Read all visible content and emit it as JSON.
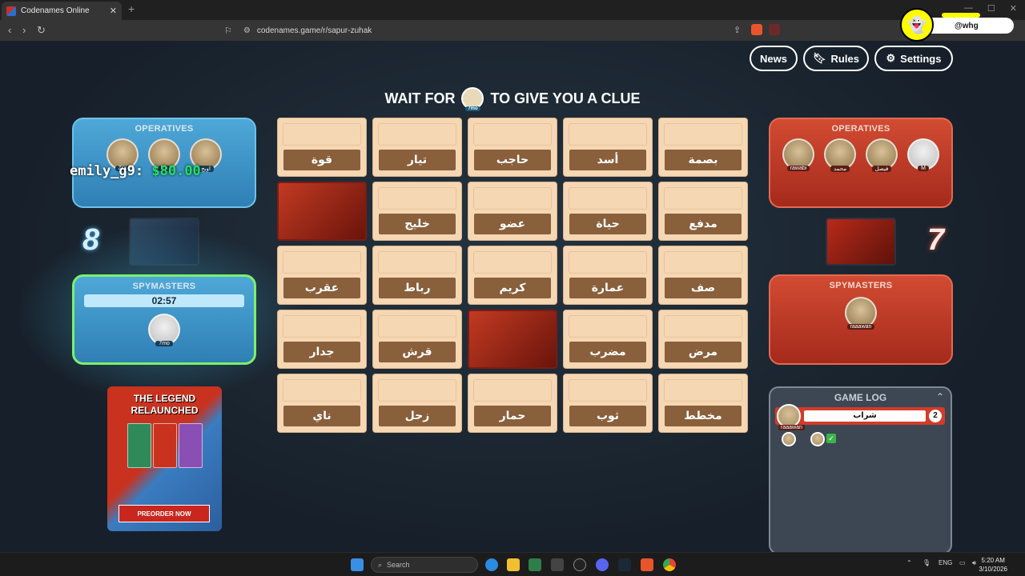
{
  "browser": {
    "tab_title": "Codenames Online",
    "tab_close": "✕",
    "new_tab": "+",
    "url": "codenames.game/r/sapur-zuhak",
    "window_controls": [
      "—",
      "☐",
      "✕"
    ]
  },
  "snap": {
    "handle": "@whg"
  },
  "nav": {
    "news": "News",
    "rules": "Rules",
    "settings": "Settings"
  },
  "clue_message": {
    "before": "WAIT FOR",
    "player": "7mo",
    "after": "TO GIVE YOU A CLUE"
  },
  "overlay": {
    "user": "emily_g9:",
    "money": "$80.00"
  },
  "blue": {
    "operatives_title": "OPERATIVES",
    "operatives": [
      {
        "name": "ZIY"
      },
      {
        "name": "Ra"
      },
      {
        "name": "اوبح"
      }
    ],
    "score": "8",
    "spymasters_title": "SPYMASTERS",
    "timer": "02:57",
    "spymaster": {
      "name": "7mo"
    }
  },
  "red": {
    "operatives_title": "OPERATIVES",
    "operatives": [
      {
        "name": "rawabi"
      },
      {
        "name": "محمد"
      },
      {
        "name": "فيصل"
      },
      {
        "name": "M"
      }
    ],
    "score": "7",
    "spymasters_title": "SPYMASTERS",
    "spymaster": {
      "name": "raaawan"
    }
  },
  "promo": {
    "title_line1": "THE LEGEND",
    "title_line2": "RELAUNCHED",
    "button": "PREORDER NOW"
  },
  "board": {
    "rows": [
      [
        "قوة",
        "تيار",
        "حاجب",
        "أسد",
        "بصمة"
      ],
      [
        "",
        "خليج",
        "عضو",
        "حياة",
        "مدفع"
      ],
      [
        "عقرب",
        "رباط",
        "كريم",
        "عمارة",
        "صف"
      ],
      [
        "جدار",
        "قرش",
        "",
        "مضرب",
        "مرض"
      ],
      [
        "ناي",
        "زحل",
        "حمار",
        "ثوب",
        "مخطط"
      ]
    ],
    "revealed_red": [
      [
        1,
        0
      ],
      [
        3,
        2
      ]
    ]
  },
  "gamelog": {
    "title": "GAME LOG",
    "entry": {
      "player": "raaawan",
      "clue": "شراب",
      "number": "2"
    }
  },
  "taskbar": {
    "search": "Search",
    "lang": "ENG",
    "time": "5:20 AM",
    "date": "3/10/2026"
  },
  "colors": {
    "blue_team": "#4ea8d8",
    "red_team": "#d24b32",
    "card": "#f5d7b3",
    "card_word": "#8a5f3b"
  }
}
